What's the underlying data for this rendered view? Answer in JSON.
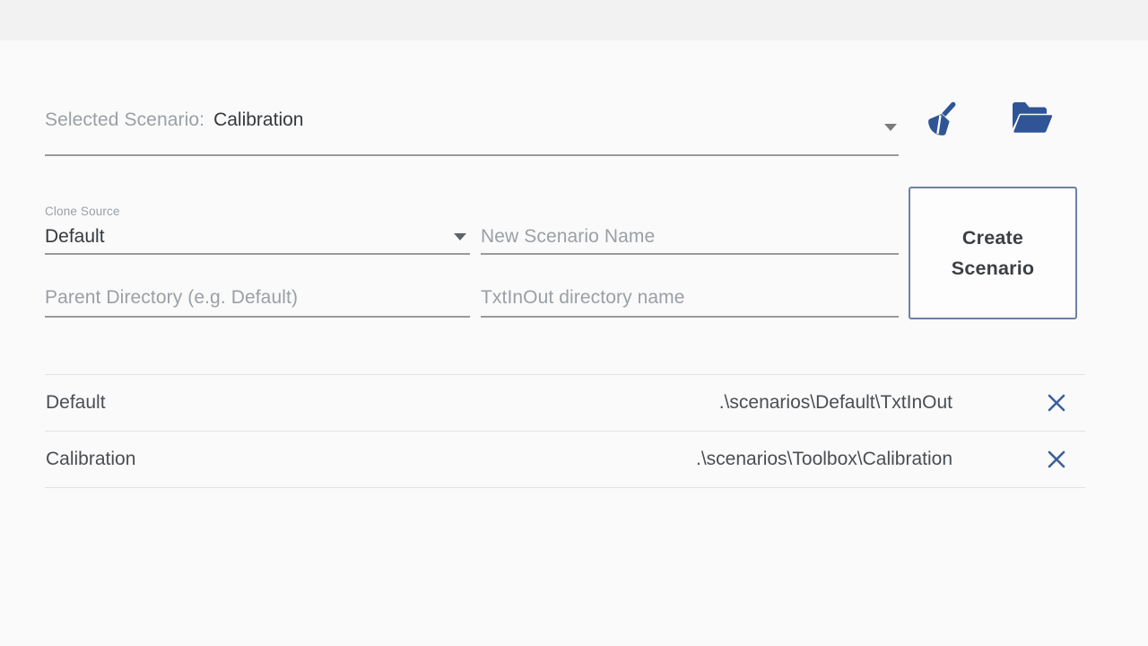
{
  "colors": {
    "accent_blue": "#2f5596",
    "delete_blue": "#3b5f9e",
    "button_border": "#6e81a4",
    "label_gray": "#9aa0a6",
    "text_dark": "#3c4043",
    "top_strip": "#f2f2f3",
    "page_background": "#fafafa",
    "underline": "#9a9a9a",
    "divider": "#e2e2e2"
  },
  "selected_scenario": {
    "label": "Selected Scenario:",
    "value": "Calibration",
    "caret_icon": "chevron-down-icon"
  },
  "toolbar": {
    "clean_icon": "broom-icon",
    "open_folder_icon": "folder-open-icon"
  },
  "form": {
    "clone_source": {
      "label": "Clone Source",
      "value": "Default",
      "caret_icon": "chevron-down-icon"
    },
    "new_scenario_name": {
      "placeholder": "New Scenario Name",
      "value": ""
    },
    "parent_directory": {
      "placeholder": "Parent Directory (e.g. Default)",
      "value": ""
    },
    "txtinout_directory": {
      "placeholder": "TxtInOut directory name",
      "value": ""
    },
    "create_button": {
      "label_line1": "Create",
      "label_line2": "Scenario"
    }
  },
  "scenario_table": {
    "rows": [
      {
        "name": "Default",
        "path": ".\\scenarios\\Default\\TxtInOut",
        "delete_icon": "close-icon"
      },
      {
        "name": "Calibration",
        "path": ".\\scenarios\\Toolbox\\Calibration",
        "delete_icon": "close-icon"
      }
    ]
  }
}
